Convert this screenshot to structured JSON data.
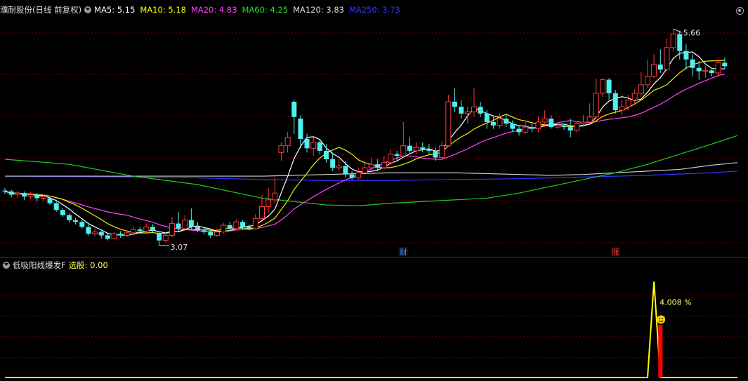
{
  "header": {
    "title": "濮耐股份(日线 前复权)",
    "ma": [
      {
        "label": "MA5: 5.15",
        "color": "#ffffff"
      },
      {
        "label": "MA10: 5.18",
        "color": "#ffff00"
      },
      {
        "label": "MA20: 4.83",
        "color": "#ff44ff"
      },
      {
        "label": "MA60: 4.25",
        "color": "#22dd22"
      },
      {
        "label": "MA120: 3.83",
        "color": "#dddddd"
      },
      {
        "label": "MA250: 3.73",
        "color": "#3333ff"
      }
    ]
  },
  "indicator": {
    "title": "低吸阳线爆发F",
    "signal_label": "选股: 0.00",
    "peak_label": "4.008 %"
  },
  "colors": {
    "up": "#ff3c3c",
    "down": "#50f0f0",
    "grid": "#7a0000"
  },
  "chart_data": {
    "type": "candlestick",
    "high_label": "5.66",
    "low_label": "3.07",
    "events": [
      {
        "index": 62,
        "text": "财",
        "color": "#3399ff"
      },
      {
        "index": 95,
        "text": "涨",
        "color": "#ff3333"
      }
    ],
    "ohlc": [
      [
        3.75,
        3.74,
        3.78,
        3.71
      ],
      [
        3.74,
        3.7,
        3.76,
        3.67
      ],
      [
        3.7,
        3.72,
        3.75,
        3.66
      ],
      [
        3.72,
        3.68,
        3.74,
        3.64
      ],
      [
        3.68,
        3.7,
        3.73,
        3.65
      ],
      [
        3.7,
        3.66,
        3.72,
        3.62
      ],
      [
        3.66,
        3.68,
        3.7,
        3.63
      ],
      [
        3.66,
        3.6,
        3.67,
        3.58
      ],
      [
        3.6,
        3.52,
        3.62,
        3.5
      ],
      [
        3.52,
        3.46,
        3.54,
        3.44
      ],
      [
        3.46,
        3.4,
        3.48,
        3.37
      ],
      [
        3.4,
        3.38,
        3.43,
        3.35
      ],
      [
        3.38,
        3.32,
        3.4,
        3.3
      ],
      [
        3.32,
        3.24,
        3.35,
        3.22
      ],
      [
        3.24,
        3.26,
        3.3,
        3.21
      ],
      [
        3.26,
        3.22,
        3.28,
        3.18
      ],
      [
        3.22,
        3.18,
        3.24,
        3.16
      ],
      [
        3.18,
        3.24,
        3.26,
        3.17
      ],
      [
        3.24,
        3.22,
        3.27,
        3.19
      ],
      [
        3.22,
        3.25,
        3.28,
        3.2
      ],
      [
        3.25,
        3.29,
        3.33,
        3.22
      ],
      [
        3.29,
        3.27,
        3.32,
        3.24
      ],
      [
        3.27,
        3.32,
        3.36,
        3.25
      ],
      [
        3.32,
        3.28,
        3.35,
        3.25
      ],
      [
        3.24,
        3.16,
        3.26,
        3.1
      ],
      [
        3.16,
        3.22,
        3.26,
        3.14
      ],
      [
        3.22,
        3.36,
        3.44,
        3.2
      ],
      [
        3.36,
        3.3,
        3.5,
        3.27
      ],
      [
        3.3,
        3.4,
        3.46,
        3.28
      ],
      [
        3.4,
        3.32,
        3.54,
        3.3
      ],
      [
        3.32,
        3.28,
        3.38,
        3.26
      ],
      [
        3.28,
        3.26,
        3.31,
        3.23
      ],
      [
        3.26,
        3.22,
        3.29,
        3.19
      ],
      [
        3.22,
        3.26,
        3.3,
        3.2
      ],
      [
        3.26,
        3.34,
        3.37,
        3.24
      ],
      [
        3.34,
        3.3,
        3.38,
        3.27
      ],
      [
        3.3,
        3.38,
        3.41,
        3.28
      ],
      [
        3.38,
        3.32,
        3.4,
        3.29
      ],
      [
        3.32,
        3.3,
        3.35,
        3.28
      ],
      [
        3.3,
        3.42,
        3.47,
        3.29
      ],
      [
        3.42,
        3.56,
        3.7,
        3.4
      ],
      [
        3.56,
        3.64,
        3.78,
        3.5
      ],
      [
        3.64,
        3.72,
        3.9,
        3.6
      ],
      [
        4.2,
        4.28,
        4.32,
        4.1
      ],
      [
        4.28,
        4.38,
        4.44,
        4.2
      ],
      [
        4.8,
        4.62,
        4.82,
        4.42
      ],
      [
        4.6,
        4.36,
        4.64,
        4.25
      ],
      [
        4.36,
        4.25,
        4.42,
        4.2
      ],
      [
        4.25,
        4.32,
        4.38,
        4.16
      ],
      [
        4.32,
        4.22,
        4.36,
        4.18
      ],
      [
        4.22,
        4.12,
        4.3,
        4.08
      ],
      [
        4.12,
        4.02,
        4.2,
        3.98
      ],
      [
        4.02,
        4.04,
        4.12,
        3.98
      ],
      [
        4.04,
        3.94,
        4.1,
        3.9
      ],
      [
        3.94,
        3.9,
        3.98,
        3.88
      ],
      [
        3.9,
        3.96,
        4.02,
        3.88
      ],
      [
        3.96,
        4.02,
        4.08,
        3.94
      ],
      [
        4.02,
        4.06,
        4.14,
        3.98
      ],
      [
        4.06,
        4.02,
        4.12,
        3.98
      ],
      [
        4.02,
        4.08,
        4.16,
        4.0
      ],
      [
        4.08,
        4.18,
        4.24,
        4.06
      ],
      [
        4.18,
        4.16,
        4.22,
        4.1
      ],
      [
        4.16,
        4.28,
        4.56,
        4.14
      ],
      [
        4.28,
        4.22,
        4.38,
        4.18
      ],
      [
        4.22,
        4.26,
        4.32,
        4.18
      ],
      [
        4.26,
        4.24,
        4.32,
        4.2
      ],
      [
        4.24,
        4.22,
        4.3,
        4.18
      ],
      [
        4.22,
        4.14,
        4.26,
        4.1
      ],
      [
        4.14,
        4.28,
        4.33,
        4.12
      ],
      [
        4.28,
        4.8,
        4.88,
        4.26
      ],
      [
        4.8,
        4.74,
        4.96,
        4.68
      ],
      [
        4.74,
        4.66,
        4.82,
        4.6
      ],
      [
        4.66,
        4.68,
        4.74,
        4.54
      ],
      [
        4.68,
        4.74,
        4.96,
        4.62
      ],
      [
        4.74,
        4.66,
        4.8,
        4.62
      ],
      [
        4.66,
        4.56,
        4.7,
        4.48
      ],
      [
        4.56,
        4.52,
        4.62,
        4.48
      ],
      [
        4.52,
        4.6,
        4.66,
        4.48
      ],
      [
        4.6,
        4.54,
        4.66,
        4.5
      ],
      [
        4.54,
        4.48,
        4.58,
        4.44
      ],
      [
        4.48,
        4.44,
        4.52,
        4.4
      ],
      [
        4.44,
        4.5,
        4.56,
        4.42
      ],
      [
        4.5,
        4.48,
        4.54,
        4.44
      ],
      [
        4.48,
        4.56,
        4.62,
        4.44
      ],
      [
        4.56,
        4.6,
        4.7,
        4.5
      ],
      [
        4.6,
        4.5,
        4.64,
        4.48
      ],
      [
        4.5,
        4.52,
        4.55,
        4.48
      ],
      [
        4.52,
        4.5,
        4.54,
        4.47
      ],
      [
        4.5,
        4.46,
        4.6,
        4.38
      ],
      [
        4.46,
        4.54,
        4.57,
        4.44
      ],
      [
        4.54,
        4.56,
        4.64,
        4.5
      ],
      [
        4.56,
        4.62,
        4.78,
        4.54
      ],
      [
        4.62,
        4.9,
        5.07,
        4.6
      ],
      [
        4.9,
        5.06,
        5.08,
        4.86
      ],
      [
        5.06,
        4.9,
        5.08,
        4.82
      ],
      [
        4.9,
        4.7,
        4.94,
        4.66
      ],
      [
        4.7,
        4.74,
        4.82,
        4.64
      ],
      [
        4.74,
        4.82,
        4.88,
        4.7
      ],
      [
        4.82,
        4.9,
        4.95,
        4.78
      ],
      [
        4.9,
        5.0,
        5.15,
        4.86
      ],
      [
        5.0,
        5.1,
        5.3,
        4.96
      ],
      [
        5.1,
        5.24,
        5.36,
        5.08
      ],
      [
        5.24,
        5.18,
        5.42,
        5.14
      ],
      [
        5.18,
        5.44,
        5.55,
        5.16
      ],
      [
        5.44,
        5.6,
        5.66,
        5.4
      ],
      [
        5.6,
        5.4,
        5.64,
        5.3
      ],
      [
        5.4,
        5.3,
        5.48,
        5.18
      ],
      [
        5.3,
        5.2,
        5.36,
        5.1
      ],
      [
        5.2,
        5.16,
        5.28,
        5.06
      ],
      [
        5.16,
        5.17,
        5.22,
        5.08
      ],
      [
        5.17,
        5.14,
        5.2,
        5.1
      ],
      [
        5.14,
        5.26,
        5.3,
        5.1
      ],
      [
        5.26,
        5.22,
        5.32,
        5.18
      ]
    ],
    "ma60": [
      [
        0,
        4.12
      ],
      [
        10,
        4.06
      ],
      [
        20,
        3.92
      ],
      [
        30,
        3.82
      ],
      [
        40,
        3.66
      ],
      [
        50,
        3.58
      ],
      [
        55,
        3.57
      ],
      [
        60,
        3.6
      ],
      [
        65,
        3.62
      ],
      [
        70,
        3.64
      ],
      [
        75,
        3.66
      ],
      [
        80,
        3.72
      ],
      [
        85,
        3.8
      ],
      [
        90,
        3.88
      ],
      [
        95,
        3.96
      ],
      [
        100,
        4.06
      ],
      [
        105,
        4.18
      ],
      [
        110,
        4.3
      ],
      [
        114,
        4.4
      ]
    ],
    "ma120": [
      [
        0,
        3.92
      ],
      [
        20,
        3.92
      ],
      [
        30,
        3.92
      ],
      [
        40,
        3.92
      ],
      [
        50,
        3.94
      ],
      [
        60,
        3.96
      ],
      [
        70,
        3.96
      ],
      [
        80,
        3.94
      ],
      [
        85,
        3.93
      ],
      [
        90,
        3.94
      ],
      [
        95,
        3.96
      ],
      [
        100,
        3.98
      ],
      [
        105,
        4.0
      ],
      [
        110,
        4.05
      ],
      [
        114,
        4.08
      ]
    ],
    "ma250": [
      [
        0,
        3.92
      ],
      [
        20,
        3.91
      ],
      [
        30,
        3.9
      ],
      [
        40,
        3.88
      ],
      [
        50,
        3.87
      ],
      [
        60,
        3.87
      ],
      [
        70,
        3.88
      ],
      [
        80,
        3.89
      ],
      [
        90,
        3.91
      ],
      [
        100,
        3.93
      ],
      [
        110,
        3.96
      ],
      [
        114,
        3.98
      ]
    ],
    "indicator": {
      "ylim": [
        0,
        4.4
      ],
      "line": [
        [
          0,
          0
        ],
        [
          100,
          0
        ],
        [
          101,
          4.008
        ],
        [
          102,
          0
        ],
        [
          114,
          0
        ]
      ],
      "bar": {
        "index": 102,
        "value": 2.2
      }
    },
    "ylim": [
      3.0,
      5.82
    ]
  }
}
